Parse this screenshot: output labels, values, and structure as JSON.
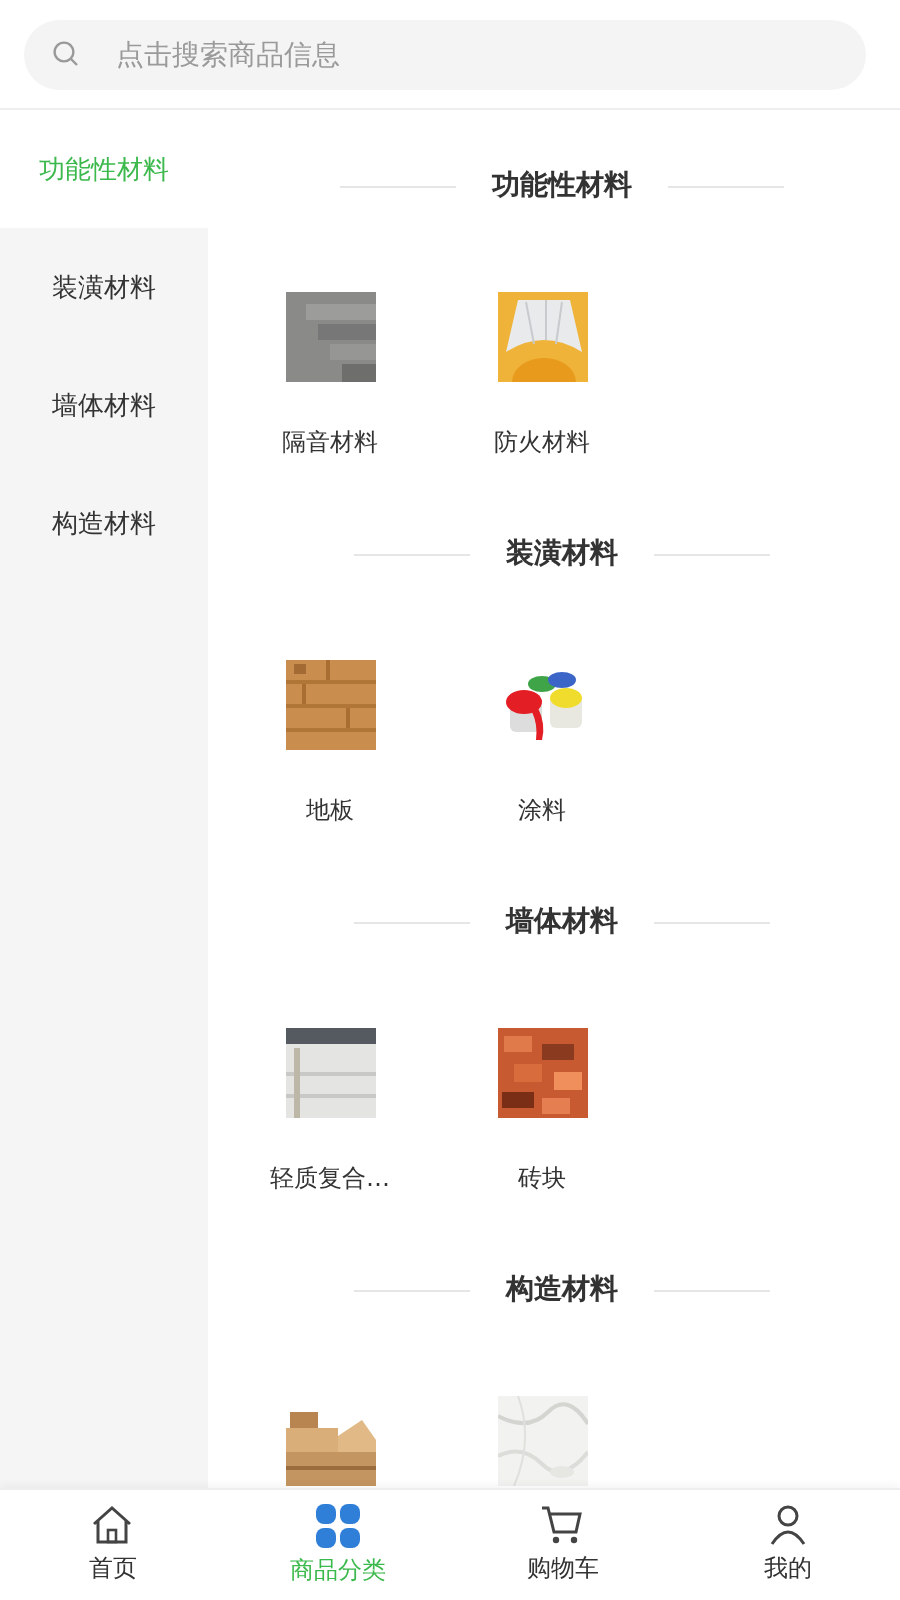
{
  "search": {
    "placeholder": "点击搜索商品信息"
  },
  "sidebar": {
    "items": [
      {
        "label": "功能性材料",
        "selected": true
      },
      {
        "label": "装潢材料",
        "selected": false
      },
      {
        "label": "墙体材料",
        "selected": false
      },
      {
        "label": "构造材料",
        "selected": false
      }
    ]
  },
  "sections": [
    {
      "title": "功能性材料",
      "items": [
        {
          "kind": "picture",
          "label": "隔音材料"
        },
        {
          "kind": "picture",
          "label": "防火材料"
        }
      ]
    },
    {
      "title": "装潢材料",
      "items": [
        {
          "kind": "picture",
          "label": "地板"
        },
        {
          "kind": "picture",
          "label": "涂料"
        }
      ]
    },
    {
      "title": "墙体材料",
      "items": [
        {
          "kind": "picture",
          "label": "轻质复合…"
        },
        {
          "kind": "picture",
          "label": "砖块"
        }
      ]
    },
    {
      "title": "构造材料"
    }
  ],
  "tab_bar": [
    {
      "kind": "home",
      "label": "首页",
      "selected": false
    },
    {
      "kind": "category",
      "label": "商品分类",
      "selected": true
    },
    {
      "kind": "cart",
      "label": "购物车",
      "selected": false
    },
    {
      "kind": "user",
      "label": "我的",
      "selected": false
    }
  ]
}
